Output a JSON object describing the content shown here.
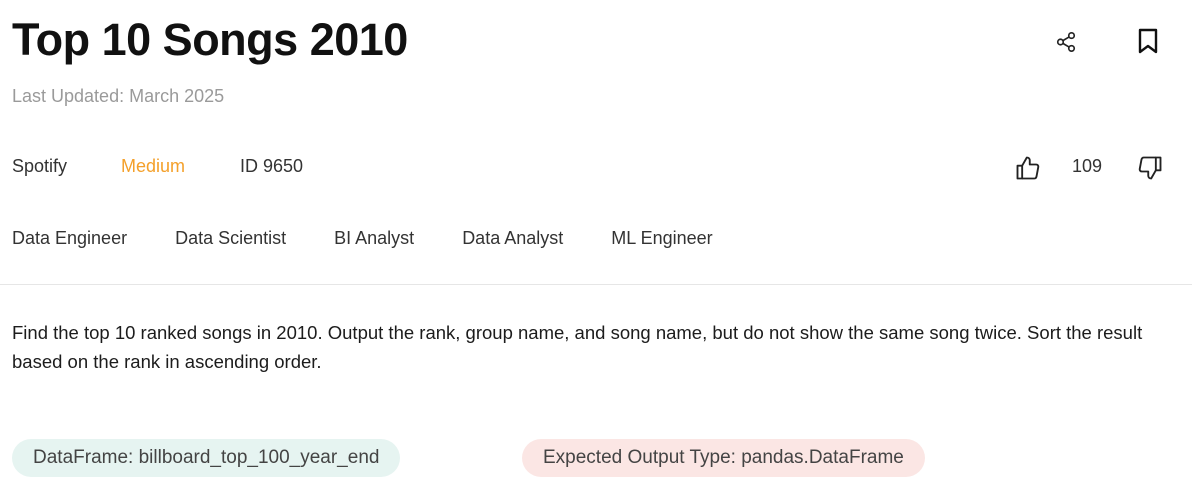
{
  "header": {
    "title": "Top 10 Songs 2010",
    "last_updated": "Last Updated: March 2025"
  },
  "meta": {
    "company": "Spotify",
    "difficulty": "Medium",
    "question_id": "ID 9650",
    "likes": "109"
  },
  "roles": [
    "Data Engineer",
    "Data Scientist",
    "BI Analyst",
    "Data Analyst",
    "ML Engineer"
  ],
  "description": "Find the top 10 ranked songs in 2010. Output the rank, group name, and song name, but do not show the same song twice. Sort the result based on the rank in ascending order.",
  "pills": {
    "dataframe": "DataFrame: billboard_top_100_year_end",
    "expected_output": "Expected Output Type: pandas.DataFrame"
  },
  "colors": {
    "difficulty_medium": "#f4a02a",
    "dataframe_pill_bg": "#e6f4f1",
    "output_pill_bg": "#fbe6e4"
  },
  "icons": [
    "share-icon",
    "bookmark-icon",
    "thumbs-up-icon",
    "thumbs-down-icon"
  ]
}
